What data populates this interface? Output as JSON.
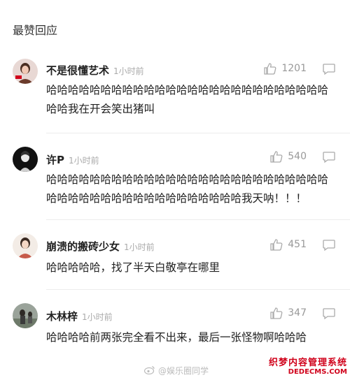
{
  "section_title": "最赞回应",
  "comments": [
    {
      "username": "不是很懂艺术",
      "time": "1小时前",
      "likes": "1201",
      "text": "哈哈哈哈哈哈哈哈哈哈哈哈哈哈哈哈哈哈哈哈哈哈哈哈哈哈哈哈我在开会笑出猪叫"
    },
    {
      "username": "许P",
      "time": "1小时前",
      "likes": "540",
      "text": "哈哈哈哈哈哈哈哈哈哈哈哈哈哈哈哈哈哈哈哈哈哈哈哈哈哈哈哈哈哈哈哈哈哈哈哈哈哈哈哈哈哈哈哈我天呐！！！"
    },
    {
      "username": "崩溃的搬砖少女",
      "time": "1小时前",
      "likes": "451",
      "text": "哈哈哈哈哈，找了半天白敬亭在哪里"
    },
    {
      "username": "木林梓",
      "time": "1小时前",
      "likes": "347",
      "text": "哈哈哈哈前两张完全看不出来，最后一张怪物啊哈哈哈"
    }
  ],
  "watermark": {
    "weibo_text": "@娱乐圈同学",
    "site_cn": "织梦内容管理系统",
    "site_en": "DEDECMS.COM"
  },
  "colors": {
    "timestamp": "#aaaaaa",
    "icon": "#aaaaaa",
    "watermark_red": "#d0021b"
  }
}
